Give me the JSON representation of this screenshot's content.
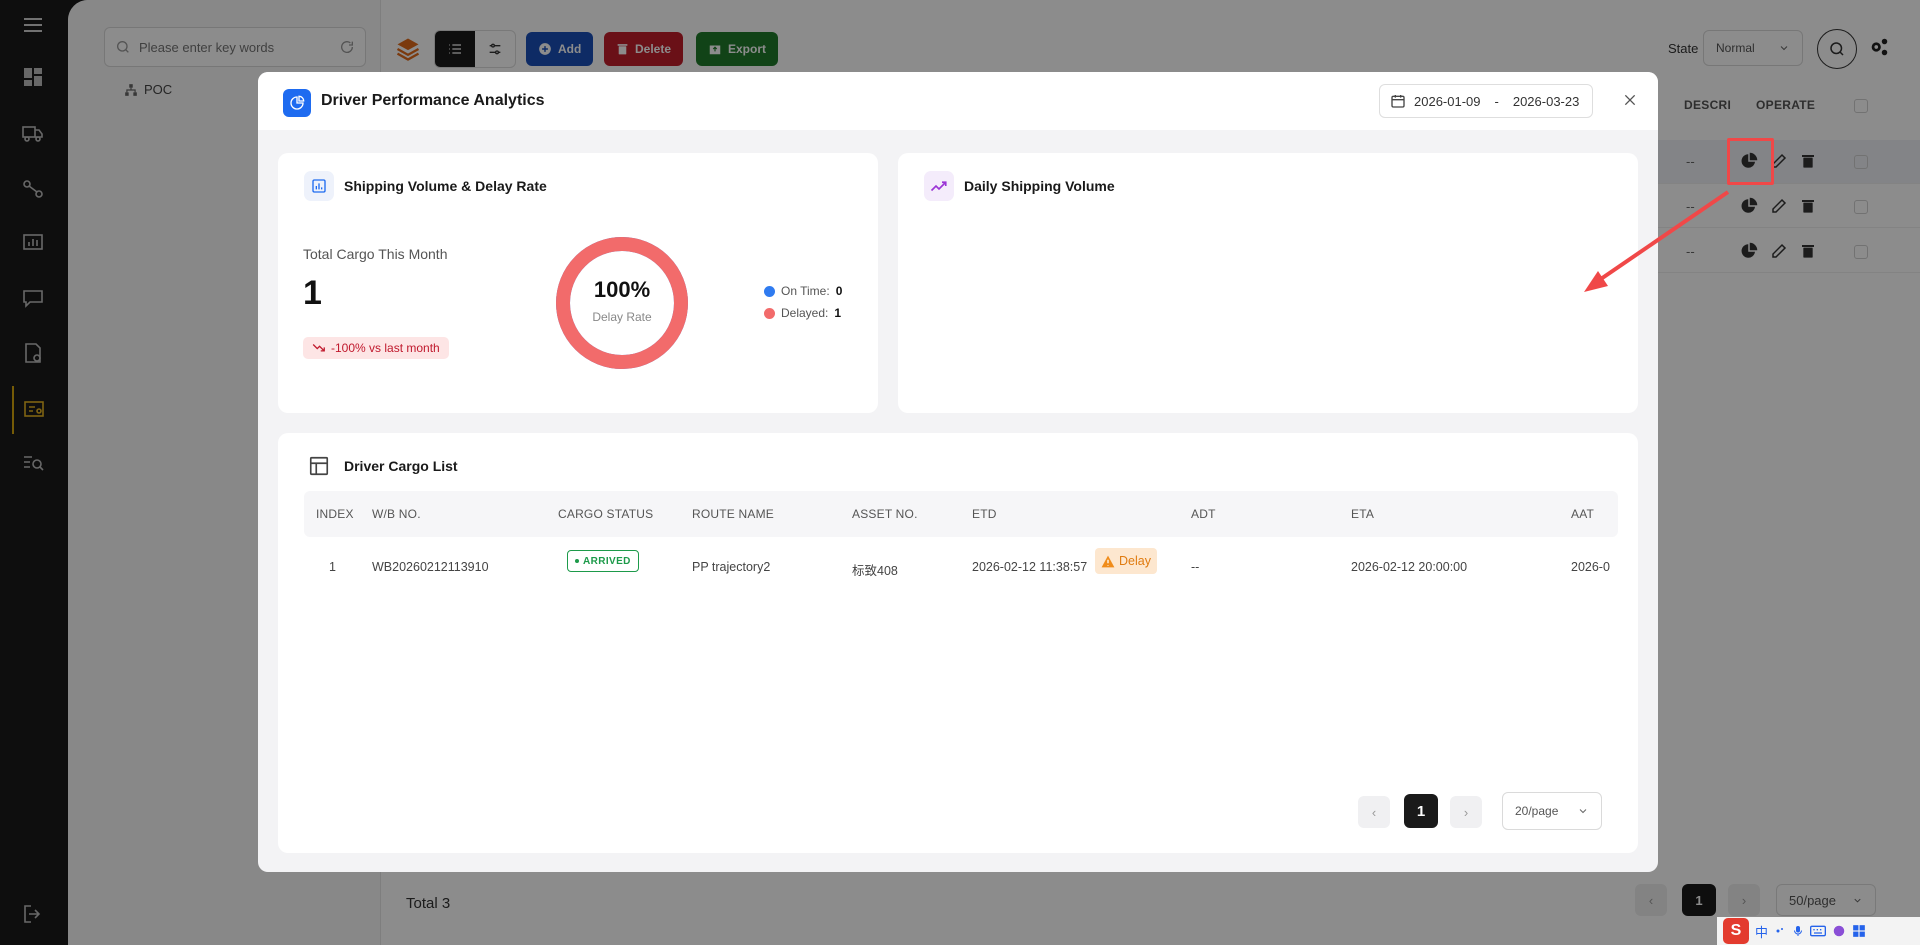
{
  "sidebar": {
    "icons": [
      "menu-icon",
      "dashboard-icon",
      "truck-icon",
      "route-icon",
      "monitor-chart-icon",
      "message-car-icon",
      "doc-clock-icon",
      "driver-report-icon",
      "search-list-icon"
    ],
    "logout_icon": "logout-icon"
  },
  "tree": {
    "search_placeholder": "Please enter key words",
    "root_node": "POC"
  },
  "toolbar": {
    "add_label": "Add",
    "delete_label": "Delete",
    "export_label": "Export",
    "state_label": "State",
    "state_value": "Normal",
    "colors": {
      "add": "#1a4fb8",
      "delete": "#c21e2a",
      "export": "#1f7a2a"
    }
  },
  "background_table": {
    "headers": {
      "description": "DESCRI",
      "operate": "OPERATE"
    },
    "rows": [
      {
        "description": "--"
      },
      {
        "description": "--"
      },
      {
        "description": "--"
      }
    ],
    "footer_total": "Total 3",
    "pager_current": "1",
    "pager_size": "50/page"
  },
  "modal": {
    "title": "Driver Performance Analytics",
    "date_start": "2026-01-09",
    "date_separator": "-",
    "date_end": "2026-03-23",
    "volume_card": {
      "title": "Shipping Volume & Delay Rate",
      "total_label": "Total Cargo This Month",
      "total_value": "1",
      "trend_text": "-100% vs last month",
      "donut_percent": "100%",
      "donut_label": "Delay Rate",
      "delay_fraction": 1.0,
      "legend": [
        {
          "label": "On Time:",
          "value": "0",
          "color": "#2f7bf0"
        },
        {
          "label": "Delayed:",
          "value": "1",
          "color": "#f26b6b"
        }
      ]
    },
    "daily_card": {
      "title": "Daily Shipping Volume"
    },
    "list_card": {
      "title": "Driver Cargo List",
      "columns": [
        "INDEX",
        "W/B NO.",
        "CARGO STATUS",
        "ROUTE NAME",
        "ASSET NO.",
        "ETD",
        "ADT",
        "ETA",
        "AAT"
      ],
      "rows": [
        {
          "index": "1",
          "wb_no": "WB20260212113910",
          "status": "ARRIVED",
          "route": "PP trajectory2",
          "asset": "标致408",
          "etd": "2026-02-12 11:38:57",
          "delay_tag": "Delay",
          "adt": "--",
          "eta": "2026-02-12 20:00:00",
          "aat": "2026-0"
        }
      ],
      "pager_current": "1",
      "pager_size": "20/page"
    }
  },
  "tray": {
    "logo": "S",
    "ime": "中"
  },
  "colors": {
    "accent_blue": "#1e6bf0",
    "delay_red": "#f26b6b",
    "annotation_red": "#f04848"
  }
}
